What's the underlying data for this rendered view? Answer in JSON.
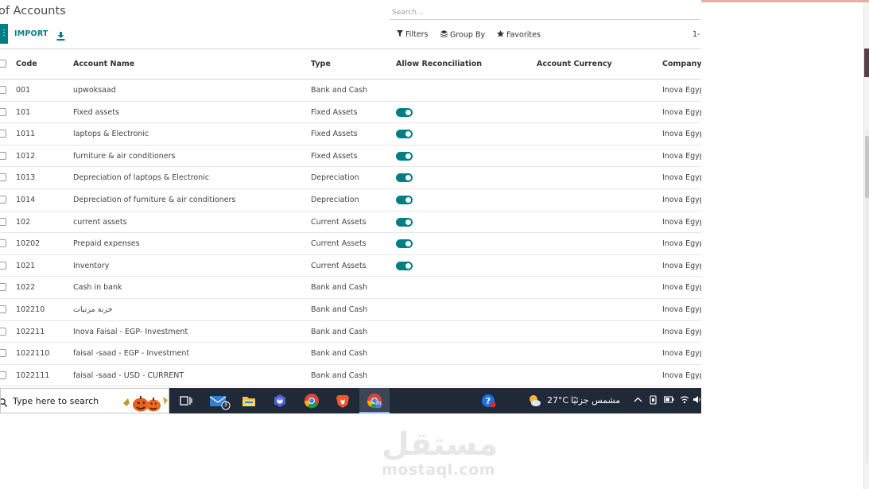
{
  "page": {
    "title": "of Accounts"
  },
  "search": {
    "placeholder": "Search..."
  },
  "toolbar": {
    "import_label": "IMPORT",
    "filters_label": "Filters",
    "groupby_label": "Group By",
    "favorites_label": "Favorites",
    "pager_text": "1-"
  },
  "colors": {
    "accent": "#017e84",
    "taskbar": "#1f2937"
  },
  "table": {
    "columns": {
      "code": "Code",
      "name": "Account Name",
      "type": "Type",
      "reconcile": "Allow Reconciliation",
      "currency": "Account Currency",
      "company": "Company"
    },
    "rows": [
      {
        "code": "001",
        "name": "upwoksaad",
        "type": "Bank and Cash",
        "reconcile": false,
        "currency": "",
        "company": "Inova Egyp"
      },
      {
        "code": "101",
        "name": "Fixed assets",
        "type": "Fixed Assets",
        "reconcile": true,
        "currency": "",
        "company": "Inova Egyp"
      },
      {
        "code": "1011",
        "name": "laptops & Electronic",
        "type": "Fixed Assets",
        "reconcile": true,
        "currency": "",
        "company": "Inova Egyp"
      },
      {
        "code": "1012",
        "name": "furniture & air conditioners",
        "type": "Fixed Assets",
        "reconcile": true,
        "currency": "",
        "company": "Inova Egyp"
      },
      {
        "code": "1013",
        "name": "Depreciation of laptops & Electronic",
        "type": "Depreciation",
        "reconcile": true,
        "currency": "",
        "company": "Inova Egyp"
      },
      {
        "code": "1014",
        "name": "Depreciation of furniture & air conditioners",
        "type": "Depreciation",
        "reconcile": true,
        "currency": "",
        "company": "Inova Egyp"
      },
      {
        "code": "102",
        "name": "current assets",
        "type": "Current Assets",
        "reconcile": true,
        "currency": "",
        "company": "Inova Egyp"
      },
      {
        "code": "10202",
        "name": "Prepaid expenses",
        "type": "Current Assets",
        "reconcile": true,
        "currency": "",
        "company": "Inova Egyp"
      },
      {
        "code": "1021",
        "name": "Inventory",
        "type": "Current Assets",
        "reconcile": true,
        "currency": "",
        "company": "Inova Egyp"
      },
      {
        "code": "1022",
        "name": "Cash in bank",
        "type": "Bank and Cash",
        "reconcile": false,
        "currency": "",
        "company": "Inova Egyp"
      },
      {
        "code": "102210",
        "name": "خزنة مرتبات",
        "type": "Bank and Cash",
        "reconcile": false,
        "currency": "",
        "company": "Inova Egyp"
      },
      {
        "code": "102211",
        "name": "Inova Faisal - EGP- Investment",
        "type": "Bank and Cash",
        "reconcile": false,
        "currency": "",
        "company": "Inova Egyp"
      },
      {
        "code": "1022110",
        "name": "faisal -saad - EGP - Investment",
        "type": "Bank and Cash",
        "reconcile": false,
        "currency": "",
        "company": "Inova Egyp"
      },
      {
        "code": "1022111",
        "name": "faisal -saad - USD - CURRENT",
        "type": "Bank and Cash",
        "reconcile": false,
        "currency": "",
        "company": "Inova Egyp"
      }
    ]
  },
  "taskbar": {
    "search_text": "Type here to search",
    "mail_badge": "3",
    "chrome_profile_letter": "m",
    "temperature": "27°C",
    "weather_text": "مشمس جزئيًا",
    "icons": [
      "pumpkins-icon",
      "task-view-icon",
      "mail-icon",
      "file-explorer-icon",
      "copilot-icon",
      "chrome-icon",
      "brave-icon",
      "chrome-profile-icon",
      "help-icon",
      "weather-icon",
      "chevron-up-icon",
      "network-icon",
      "battery-icon",
      "wifi-icon",
      "speaker-icon"
    ]
  },
  "watermark": {
    "arabic": "مستقل",
    "latin": "mostaql.com"
  }
}
